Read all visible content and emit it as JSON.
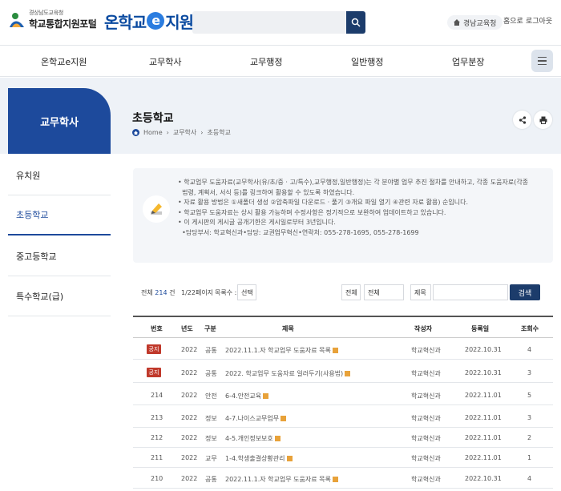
{
  "header": {
    "org_small": "경상남도교육청",
    "portal_name": "학교통합지원포털",
    "brand_pre": "온학교",
    "brand_e": "e",
    "brand_post": "지원",
    "search_placeholder": "",
    "util_home": "경남교육청",
    "util_home_link": "홈으로",
    "util_login": "로그아웃"
  },
  "nav": {
    "items": [
      "온학교e지원",
      "교무학사",
      "교무행정",
      "일반행정",
      "업무분장"
    ]
  },
  "sidebar": {
    "heading": "교무학사",
    "items": [
      "유치원",
      "초등학교",
      "중고등학교",
      "특수학교(급)"
    ]
  },
  "page": {
    "title": "초등학교",
    "breadcrumb": [
      "Home",
      "교무학사",
      "초등학교"
    ]
  },
  "notice": {
    "lines": [
      "학교업무 도움자료(교무학사(유/초/중 · 고/특수),교무행정,일반행정)는 각 분야별 업무 추진 절차를 안내하고, 각종 도움자료(각종",
      "법령, 계획서, 서식 등)를 링크하여 활용할 수 있도록 하였습니다.",
      "자료 활용 방법은 ①새폴더 생성 ②압축파일 다운로드 · 풀기 ③개요 파일 열기 ④관련 자료 활용) 순입니다.",
      "학교업무 도움자료는 상시 활용 가능하며 수정사항은 정기적으로 보완하여 업데이트하고 있습니다.",
      "이 게시판의 게시글 공개기한은 게시일로부터 3년입니다.",
      "•담당부서: 학교혁신과•담당: 교권업무혁신•연락처: 055-278-1695, 055-278-1699"
    ]
  },
  "filter": {
    "total_prefix": "전체",
    "total_count": "214",
    "total_suffix": "건",
    "page_info": "1/22페이지",
    "category_label": "목록수 :",
    "category_value": "선택",
    "filter1_label": "전체",
    "filter1_value": "전체",
    "filter2_value": "제목",
    "search_button": "검색"
  },
  "table": {
    "headers": [
      "번호",
      "년도",
      "구분",
      "제목",
      "작성자",
      "등록일",
      "조회수"
    ],
    "rows": [
      {
        "no": "공지",
        "notice": true,
        "year": "2022",
        "cat": "공통",
        "title": "2022.11.1.자 학교업무 도움자료 목록",
        "author": "학교혁신과",
        "date": "2022.10.31",
        "views": "4"
      },
      {
        "no": "공지",
        "notice": true,
        "year": "2022",
        "cat": "공통",
        "title": "2022. 학교업무 도움자료 일러두기(사용법)",
        "author": "학교혁신과",
        "date": "2022.10.31",
        "views": "3"
      },
      {
        "no": "214",
        "notice": false,
        "year": "2022",
        "cat": "안전",
        "title": "6-4.안전교육",
        "author": "학교혁신과",
        "date": "2022.11.01",
        "views": "5"
      },
      {
        "no": "213",
        "notice": false,
        "year": "2022",
        "cat": "정보",
        "title": "4-7.나이스교무업무",
        "author": "학교혁신과",
        "date": "2022.11.01",
        "views": "3"
      },
      {
        "no": "212",
        "notice": false,
        "year": "2022",
        "cat": "정보",
        "title": "4-5.개인정보보호",
        "author": "학교혁신과",
        "date": "2022.11.01",
        "views": "2"
      },
      {
        "no": "211",
        "notice": false,
        "year": "2022",
        "cat": "교무",
        "title": "1-4.학생출결상황관리",
        "author": "학교혁신과",
        "date": "2022.11.01",
        "views": "1"
      },
      {
        "no": "210",
        "notice": false,
        "year": "2022",
        "cat": "공통",
        "title": "2022.11.1.자 학교업무 도움자료 목록",
        "author": "학교혁신과",
        "date": "2022.10.31",
        "views": "4"
      }
    ]
  }
}
